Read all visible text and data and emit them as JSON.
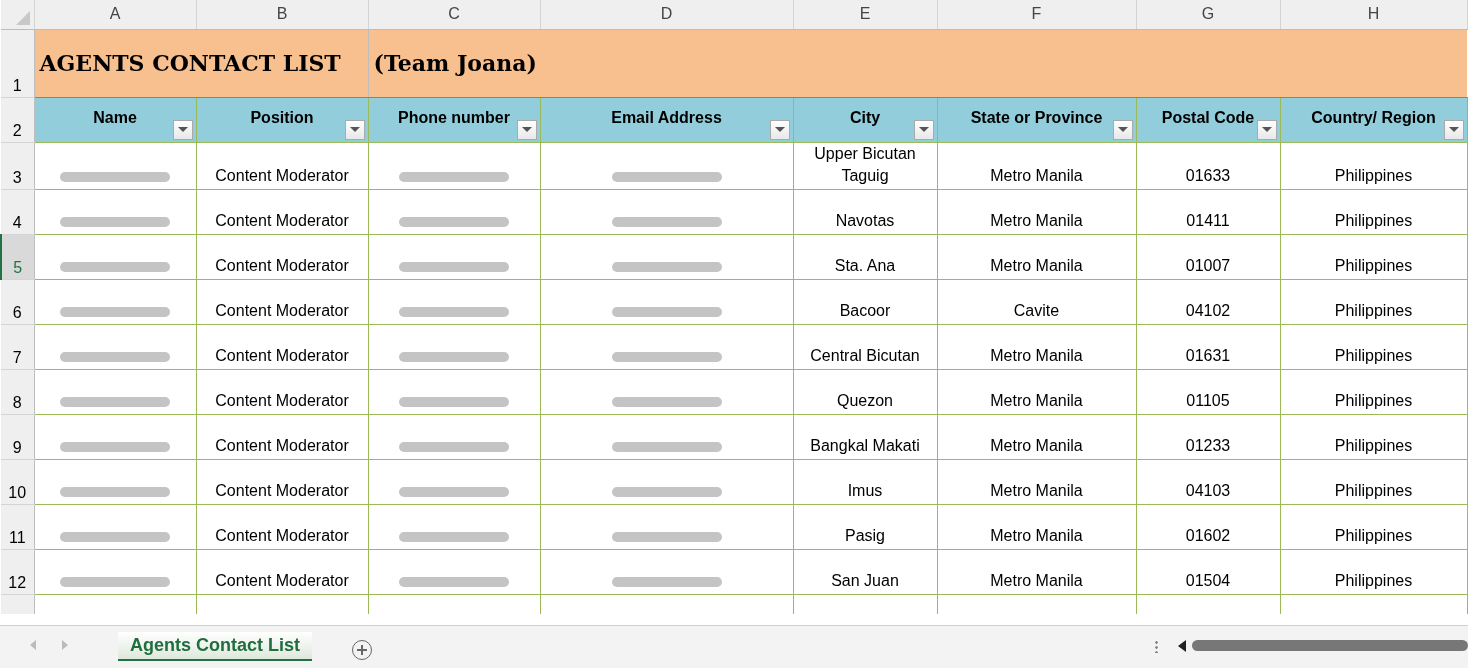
{
  "column_headers": [
    "A",
    "B",
    "C",
    "D",
    "E",
    "F",
    "G",
    "H"
  ],
  "title": {
    "main": "AGENTS CONTACT LIST",
    "team": "(Team Joana)"
  },
  "header_row": [
    "Name",
    "Position",
    "Phone number",
    "Email Address",
    "City",
    "State or Province",
    "Postal Code",
    "Country/ Region"
  ],
  "rows": [
    {
      "number": "3",
      "selected": false,
      "cells": [
        {
          "redacted": true
        },
        "Content Moderator",
        {
          "redacted": true
        },
        {
          "redacted": true
        },
        "Upper Bicutan Taguig",
        "Metro Manila",
        "01633",
        "Philippines"
      ]
    },
    {
      "number": "4",
      "selected": false,
      "cells": [
        {
          "redacted": true
        },
        "Content Moderator",
        {
          "redacted": true
        },
        {
          "redacted": true
        },
        "Navotas",
        "Metro Manila",
        "01411",
        "Philippines"
      ]
    },
    {
      "number": "5",
      "selected": true,
      "cells": [
        {
          "redacted": true
        },
        "Content Moderator",
        {
          "redacted": true
        },
        {
          "redacted": true
        },
        "Sta. Ana",
        "Metro Manila",
        "01007",
        "Philippines"
      ]
    },
    {
      "number": "6",
      "selected": false,
      "cells": [
        {
          "redacted": true
        },
        "Content Moderator",
        {
          "redacted": true
        },
        {
          "redacted": true
        },
        "Bacoor",
        "Cavite",
        "04102",
        "Philippines"
      ]
    },
    {
      "number": "7",
      "selected": false,
      "cells": [
        {
          "redacted": true
        },
        "Content Moderator",
        {
          "redacted": true
        },
        {
          "redacted": true
        },
        "Central Bicutan",
        "Metro Manila",
        "01631",
        "Philippines"
      ]
    },
    {
      "number": "8",
      "selected": false,
      "cells": [
        {
          "redacted": true
        },
        "Content Moderator",
        {
          "redacted": true
        },
        {
          "redacted": true
        },
        "Quezon",
        "Metro Manila",
        "01105",
        "Philippines"
      ]
    },
    {
      "number": "9",
      "selected": false,
      "cells": [
        {
          "redacted": true
        },
        "Content Moderator",
        {
          "redacted": true
        },
        {
          "redacted": true
        },
        "Bangkal Makati",
        "Metro Manila",
        "01233",
        "Philippines"
      ]
    },
    {
      "number": "10",
      "selected": false,
      "cells": [
        {
          "redacted": true
        },
        "Content Moderator",
        {
          "redacted": true
        },
        {
          "redacted": true
        },
        "Imus",
        "Metro Manila",
        "04103",
        "Philippines"
      ]
    },
    {
      "number": "11",
      "selected": false,
      "cells": [
        {
          "redacted": true
        },
        "Content Moderator",
        {
          "redacted": true
        },
        {
          "redacted": true
        },
        "Pasig",
        "Metro Manila",
        "01602",
        "Philippines"
      ]
    },
    {
      "number": "12",
      "selected": false,
      "cells": [
        {
          "redacted": true
        },
        "Content Moderator",
        {
          "redacted": true
        },
        {
          "redacted": true
        },
        "San Juan",
        "Metro Manila",
        "01504",
        "Philippines"
      ]
    }
  ],
  "row_labels": [
    "1",
    "2"
  ],
  "sheet_tabs": [
    {
      "label": "Agents Contact List",
      "selected": true
    }
  ]
}
